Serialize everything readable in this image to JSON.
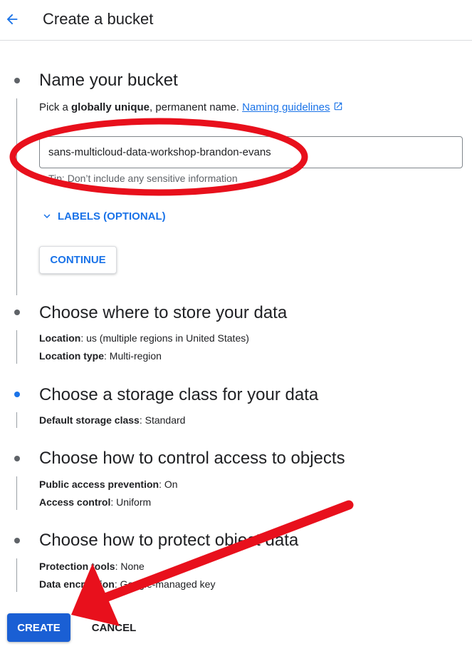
{
  "header": {
    "title": "Create a bucket",
    "back_icon": "arrow-back-icon"
  },
  "steps": {
    "name": {
      "title": "Name your bucket",
      "help_prefix": "Pick a ",
      "help_bold": "globally unique",
      "help_suffix": ", permanent name. ",
      "link_label": "Naming guidelines",
      "input_value": "sans-multicloud-data-workshop-brandon-evans",
      "tip": "Tip: Don’t include any sensitive information",
      "labels_toggle": "LABELS (OPTIONAL)",
      "continue_label": "CONTINUE"
    },
    "location": {
      "title": "Choose where to store your data",
      "rows": [
        {
          "key": "Location",
          "value": ": us (multiple regions in United States)"
        },
        {
          "key": "Location type",
          "value": ": Multi-region"
        }
      ]
    },
    "storage_class": {
      "title": "Choose a storage class for your data",
      "rows": [
        {
          "key": "Default storage class",
          "value": ": Standard"
        }
      ]
    },
    "access": {
      "title": "Choose how to control access to objects",
      "rows": [
        {
          "key": "Public access prevention",
          "value": ": On"
        },
        {
          "key": "Access control",
          "value": ": Uniform"
        }
      ]
    },
    "protection": {
      "title": "Choose how to protect object data",
      "rows": [
        {
          "key": "Protection tools",
          "value": ": None"
        },
        {
          "key": "Data encryption",
          "value": ": Google-managed key"
        }
      ]
    }
  },
  "actions": {
    "create_label": "CREATE",
    "cancel_label": "CANCEL"
  },
  "colors": {
    "accent": "#1a73e8",
    "primary_button": "#1a5fd4",
    "annotation": "#e8101c"
  },
  "annotations": [
    "red-ellipse-around-bucket-name",
    "red-arrow-pointing-to-create"
  ]
}
